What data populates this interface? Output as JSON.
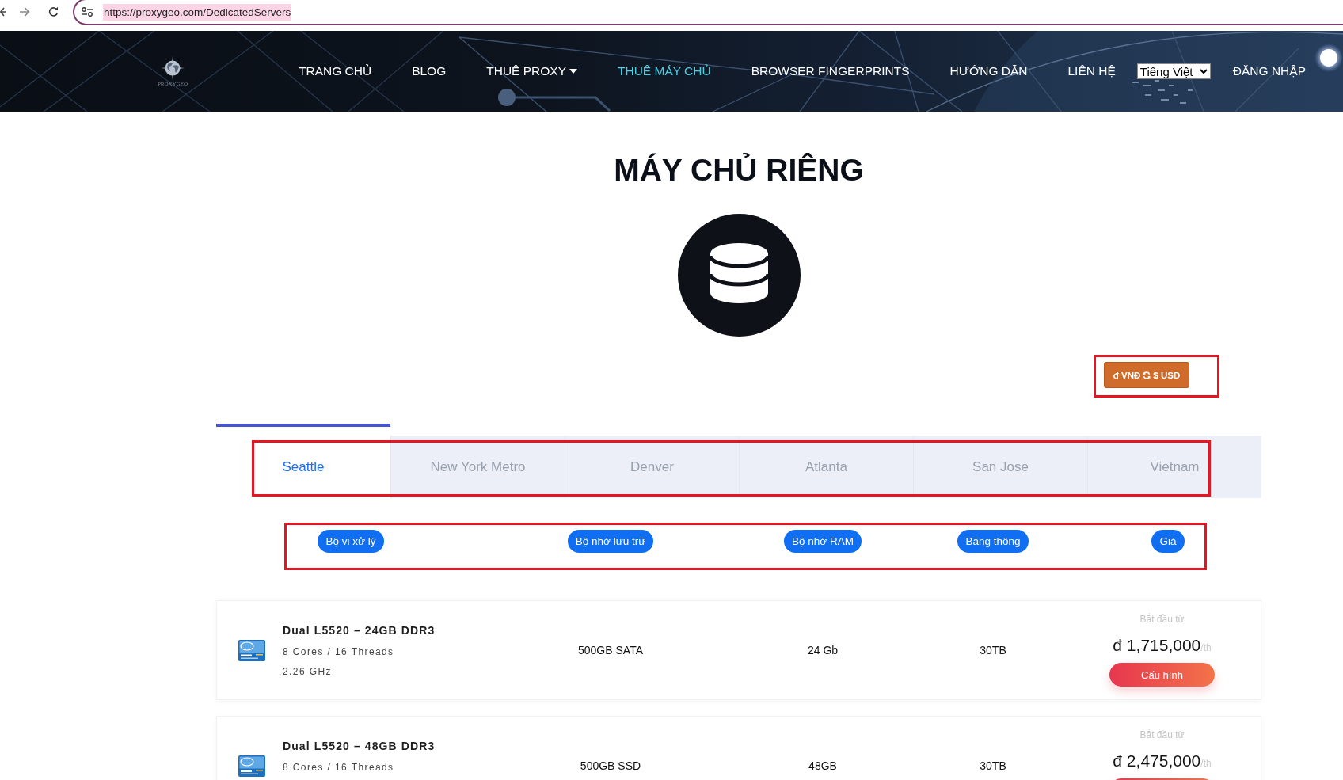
{
  "browser": {
    "url": "https://proxygeo.com/DedicatedServers"
  },
  "nav": {
    "logo_text": "PROXYGEO",
    "items": [
      {
        "label": "TRANG CHỦ",
        "selected": false,
        "dropdown": false
      },
      {
        "label": "BLOG",
        "selected": false,
        "dropdown": false
      },
      {
        "label": "THUÊ PROXY",
        "selected": false,
        "dropdown": true
      },
      {
        "label": "THUÊ MÁY CHỦ",
        "selected": true,
        "dropdown": false
      },
      {
        "label": "BROWSER FINGERPRINTS",
        "selected": false,
        "dropdown": false
      },
      {
        "label": "HƯỚNG DẪN",
        "selected": false,
        "dropdown": false
      },
      {
        "label": "LIÊN HỆ",
        "selected": false,
        "dropdown": false
      }
    ],
    "language": "Tiếng Việt",
    "login": "ĐĂNG NHẬP"
  },
  "page": {
    "title": "MÁY CHỦ RIÊNG"
  },
  "currency_toggle": {
    "from": "đ VNĐ",
    "to": "$ USD",
    "highlighted": true
  },
  "location_tabs": {
    "highlighted": true,
    "items": [
      {
        "label": "Seattle",
        "selected": true
      },
      {
        "label": "New York Metro",
        "selected": false
      },
      {
        "label": "Denver",
        "selected": false
      },
      {
        "label": "Atlanta",
        "selected": false
      },
      {
        "label": "San Jose",
        "selected": false
      },
      {
        "label": "Vietnam",
        "selected": false
      }
    ]
  },
  "columns": {
    "highlighted": true,
    "items": [
      "Bộ vi xử lý",
      "Bộ nhớ lưu trữ",
      "Bộ nhớ RAM",
      "Băng thông",
      "Giá"
    ]
  },
  "servers": [
    {
      "name": "Dual L5520 – 24GB DDR3",
      "cores": "8 Cores / 16 Threads",
      "clock": "2.26 GHz",
      "storage": "500GB SATA",
      "ram": "24 Gb",
      "bandwidth": "30TB",
      "price_label": "Bắt đầu từ",
      "price": "đ 1,715,000",
      "unit": "/th",
      "button": "Cấu hình"
    },
    {
      "name": "Dual L5520 – 48GB DDR3",
      "cores": "8 Cores / 16 Threads",
      "storage": "500GB SSD",
      "ram": "48GB",
      "bandwidth": "30TB",
      "price_label": "Bắt đầu từ",
      "price": "đ 2,475,000",
      "unit": "/th",
      "button_cut_off": true
    }
  ]
}
